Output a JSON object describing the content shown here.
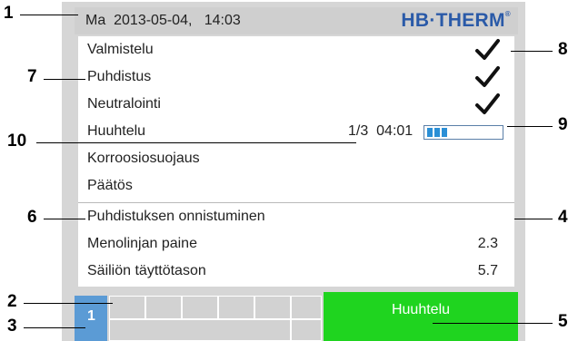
{
  "header": {
    "date_time": "Ma  2013-05-04,   14:03",
    "logo": "HB·THERM",
    "logo_mark": "®"
  },
  "steps": [
    {
      "label": "Valmistelu",
      "status": "done"
    },
    {
      "label": "Puhdistus",
      "status": "done"
    },
    {
      "label": "Neutralointi",
      "status": "done"
    },
    {
      "label": "Huuhtelu",
      "status": "active",
      "cycle": "1/3",
      "time": "04:01",
      "progress": 0.3
    },
    {
      "label": "Korroosiosuojaus",
      "status": "pending"
    },
    {
      "label": "Päätös",
      "status": "pending"
    }
  ],
  "results": {
    "title": "Puhdistuksen onnistuminen",
    "items": [
      {
        "label": "Menolinjan paine",
        "value": "2.3"
      },
      {
        "label": "Säiliön täyttötason",
        "value": "5.7"
      }
    ]
  },
  "bottom": {
    "address": "1",
    "mode_button": "Huuhtelu"
  },
  "callouts": [
    "1",
    "2",
    "3",
    "4",
    "5",
    "6",
    "7",
    "8",
    "9",
    "10"
  ],
  "colors": {
    "frame": "#d6d6d6",
    "logo": "#2a5aa8",
    "progress": "#2b8fd6",
    "address_tile": "#5b9bd5",
    "mode_button": "#1fd41f"
  },
  "icons": {
    "done": "checkmark-icon"
  }
}
